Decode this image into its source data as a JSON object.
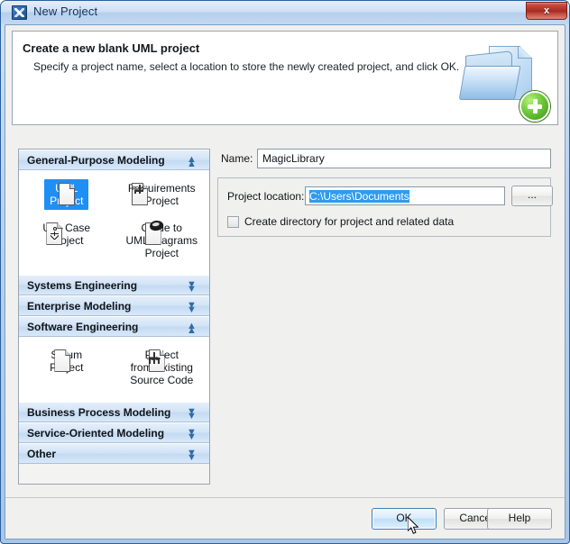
{
  "window": {
    "title": "New Project",
    "title_icon": "app-logo-icon",
    "close_label": "x"
  },
  "header": {
    "title": "Create a new blank UML project",
    "subtitle": "Specify a project name, select a location to store the newly created project, and click OK.",
    "art_icon": "new-project-folder-plus-icon"
  },
  "categories": [
    {
      "name": "General-Purpose Modeling",
      "expanded": true,
      "chevron": "chevron-up-icon",
      "items": [
        {
          "label_line1": "UML",
          "label_line2": "Project",
          "icon": "document-icon",
          "selected": true
        },
        {
          "label_line1": "Requirements",
          "label_line2": "Project",
          "icon": "requirements-document-icon",
          "selected": false
        },
        {
          "label_line1": "Use Case",
          "label_line2": "Project",
          "icon": "use-case-actor-document-icon",
          "selected": false
        },
        {
          "label_line1": "Guide to",
          "label_line2": "UML Diagrams",
          "label_line3": "Project",
          "icon": "guide-book-icon",
          "selected": false
        }
      ]
    },
    {
      "name": "Systems Engineering",
      "expanded": false,
      "chevron": "chevron-down-icon",
      "items": []
    },
    {
      "name": "Enterprise Modeling",
      "expanded": false,
      "chevron": "chevron-down-icon",
      "items": []
    },
    {
      "name": "Software Engineering",
      "expanded": true,
      "chevron": "chevron-up-icon",
      "items": [
        {
          "label_line1": "Scrum",
          "label_line2": "Project",
          "icon": "document-icon",
          "selected": false
        },
        {
          "label_line1": "Project",
          "label_line2": "from Existing",
          "label_line3": "Source Code",
          "icon": "source-code-document-icon",
          "selected": false
        }
      ]
    },
    {
      "name": "Business Process Modeling",
      "expanded": false,
      "chevron": "chevron-down-icon",
      "items": []
    },
    {
      "name": "Service-Oriented Modeling",
      "expanded": false,
      "chevron": "chevron-down-icon",
      "items": []
    },
    {
      "name": "Other",
      "expanded": false,
      "chevron": "chevron-down-icon",
      "items": []
    }
  ],
  "form": {
    "name_label": "Name:",
    "name_value": "MagicLibrary",
    "location_label": "Project location:",
    "location_value": "C:\\Users\\Documents",
    "location_selected": true,
    "browse_label": "...",
    "checkbox_label": "Create directory for project and related data",
    "checkbox_checked": false
  },
  "footer": {
    "ok_label": "OK",
    "cancel_label": "Cancel",
    "help_label": "Help",
    "default_button": "OK"
  },
  "colors": {
    "titlebar_accent": "#b5cfec",
    "selection_blue": "#1f8ff5",
    "text_selection_blue": "#2f9bf0",
    "close_red": "#a72b22",
    "category_header": "#d2e3f6",
    "default_button_border": "#3c7fb1"
  }
}
